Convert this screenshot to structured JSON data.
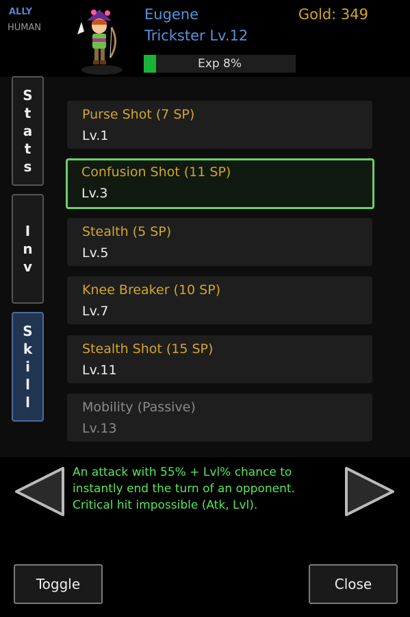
{
  "character": {
    "faction": "ALLY",
    "race": "HUMAN",
    "name": "Eugene",
    "class_level": "Trickster Lv.12",
    "gold": "Gold: 349",
    "exp_text": "Exp 8%",
    "exp_fraction": 0.08
  },
  "tabs": [
    {
      "label": [
        "S",
        "t",
        "a",
        "t",
        "s"
      ],
      "active": false
    },
    {
      "label": [
        "I",
        "n",
        "v"
      ],
      "active": false
    },
    {
      "label": [
        "S",
        "k",
        "i",
        "l",
        "l"
      ],
      "active": true
    }
  ],
  "skills": [
    {
      "name": "Purse Shot (7 SP)",
      "level": "Lv.1"
    },
    {
      "name": "Confusion Shot (11 SP)",
      "level": "Lv.3"
    },
    {
      "name": "Stealth (5 SP)",
      "level": "Lv.5"
    },
    {
      "name": "Knee Breaker (10 SP)",
      "level": "Lv.7"
    },
    {
      "name": "Stealth Shot (15 SP)",
      "level": "Lv.11"
    },
    {
      "name": "Mobility (Passive)",
      "level": "Lv.13"
    }
  ],
  "description": [
    "An attack with 55% + Lvl% chance to",
    "instantly end the turn of an opponent.",
    "Critical hit impossible (Atk, Lvl)."
  ],
  "buttons": {
    "toggle": "Toggle",
    "close": "Close"
  },
  "colors": {
    "gold_text": "#d2a52c",
    "name_text": "#5a93dd",
    "selected_border": "#6ccf6c",
    "description_text": "#57e85c",
    "exp_fill": "#1bb23a"
  }
}
